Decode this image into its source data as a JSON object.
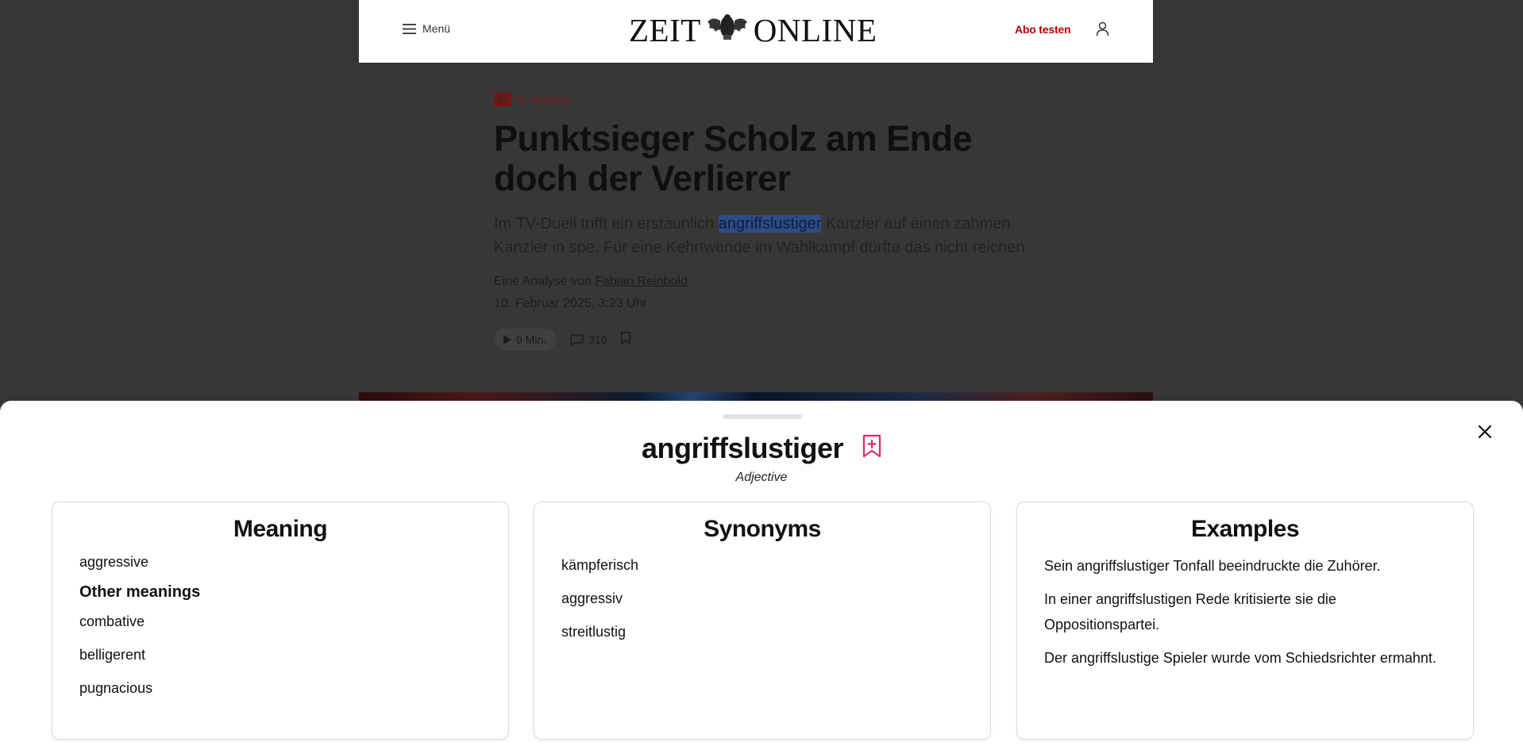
{
  "header": {
    "menu_label": "Menü",
    "logo_left": "ZEIT",
    "logo_right": "ONLINE",
    "subscribe_label": "Abo testen"
  },
  "article": {
    "badge": "Z+",
    "kicker": "TV-Debatte",
    "headline": "Punktsieger Scholz am Ende doch der Verlierer",
    "lead_before": "Im TV-Duell trifft ein erstaunlich ",
    "lead_highlight": "angriffslustiger",
    "lead_after": " Kanzler auf einen zahmen Kanzler in spe. Für eine Kehrtwende im Wahlkampf dürfte das nicht reichen.",
    "byline_prefix": "Eine Analyse von ",
    "author": "Fabian Reinbold",
    "date": "10. Februar 2025, 3:23 Uhr",
    "listen_duration": "9 Min.",
    "comment_count": "316"
  },
  "dictionary": {
    "word": "angriffslustiger",
    "part_of_speech": "Adjective",
    "meaning": {
      "title": "Meaning",
      "primary": "aggressive",
      "other_title": "Other meanings",
      "other": [
        "combative",
        "belligerent",
        "pugnacious"
      ]
    },
    "synonyms": {
      "title": "Synonyms",
      "items": [
        "kämpferisch",
        "aggressiv",
        "streitlustig"
      ]
    },
    "examples": {
      "title": "Examples",
      "items": [
        "Sein angriffslustiger Tonfall beeindruckte die Zuhörer.",
        "In einer angriffslustigen Rede kritisierte sie die Oppositionspartei.",
        "Der angriffslustige Spieler wurde vom Schiedsrichter ermahnt."
      ]
    }
  },
  "colors": {
    "overlay": "#363636",
    "brand_red": "#b40000",
    "bookmark_pink": "#e0286e",
    "highlight": "#2e4d86"
  }
}
